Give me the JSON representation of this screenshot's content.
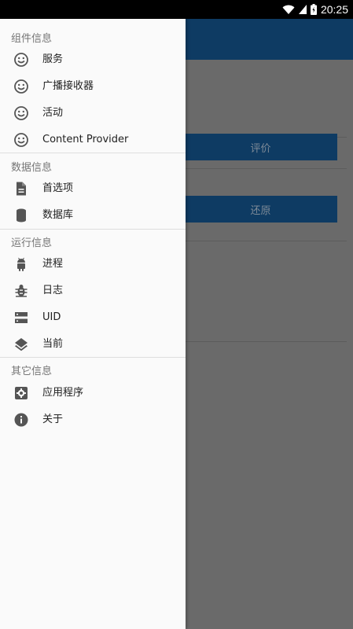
{
  "status_bar": {
    "time": "20:25"
  },
  "app": {
    "button_rate": "评价",
    "button_restore": "还原"
  },
  "drawer": {
    "sections": [
      {
        "header": "组件信息",
        "items": [
          {
            "label": "服务",
            "icon": "smiley-icon"
          },
          {
            "label": "广播接收器",
            "icon": "smiley-icon"
          },
          {
            "label": "活动",
            "icon": "smiley-icon"
          },
          {
            "label": "Content Provider",
            "icon": "smiley-icon"
          }
        ]
      },
      {
        "header": "数据信息",
        "items": [
          {
            "label": "首选项",
            "icon": "document-icon"
          },
          {
            "label": "数据库",
            "icon": "database-icon"
          }
        ]
      },
      {
        "header": "运行信息",
        "items": [
          {
            "label": "进程",
            "icon": "android-icon"
          },
          {
            "label": "日志",
            "icon": "bug-icon"
          },
          {
            "label": "UID",
            "icon": "storage-icon"
          },
          {
            "label": "当前",
            "icon": "layers-icon"
          }
        ]
      },
      {
        "header": "其它信息",
        "items": [
          {
            "label": "应用程序",
            "icon": "settings-icon"
          },
          {
            "label": "关于",
            "icon": "info-icon"
          }
        ]
      }
    ]
  }
}
